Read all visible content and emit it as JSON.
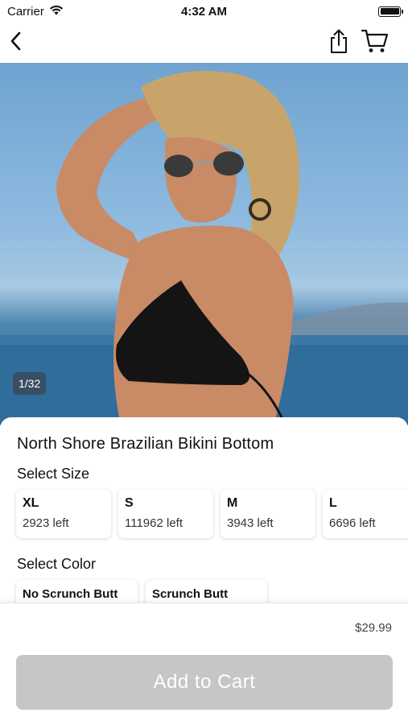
{
  "status_bar": {
    "carrier": "Carrier",
    "time": "4:32 AM"
  },
  "nav": {
    "back_icon": "chevron-left-icon",
    "share_icon": "share-icon",
    "cart_icon": "cart-icon"
  },
  "gallery": {
    "page_indicator": "1/32"
  },
  "product": {
    "title": "North Shore Brazilian Bikini Bottom",
    "select_size_label": "Select Size",
    "sizes": [
      {
        "name": "XL",
        "stock": "2923 left"
      },
      {
        "name": "S",
        "stock": "111962 left"
      },
      {
        "name": "M",
        "stock": "3943 left"
      },
      {
        "name": "L",
        "stock": "6696 left"
      }
    ],
    "select_color_label": "Select Color",
    "colors": [
      {
        "name": "No Scrunch Butt"
      },
      {
        "name": "Scrunch Butt"
      }
    ]
  },
  "footer": {
    "price": "$29.99",
    "add_to_cart_label": "Add to Cart"
  },
  "colors": {
    "button_disabled": "#c6c6c6",
    "sky": "#8fbbe0",
    "sea": "#2f6d9b"
  }
}
